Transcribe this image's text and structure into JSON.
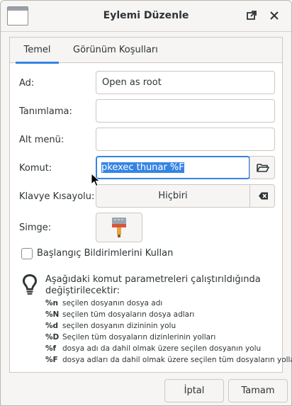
{
  "window": {
    "title": "Eylemi Düzenle"
  },
  "titlebar": {
    "icons": [
      "app-icon",
      "maximize-icon",
      "close-icon"
    ]
  },
  "tabs": [
    {
      "label": "Temel",
      "active": true
    },
    {
      "label": "Görünüm Koşulları",
      "active": false
    }
  ],
  "form": {
    "name_label": "Ad:",
    "name_value": "Open as root",
    "description_label": "Tanımlama:",
    "description_value": "",
    "submenu_label": "Alt menü:",
    "submenu_value": "",
    "command_label": "Komut:",
    "command_value": "pkexec thunar %F",
    "shortcut_label": "Klavye Kısayolu:",
    "shortcut_value": "Hiçbiri",
    "icon_label": "Simge:",
    "startup_notify_label": "Başlangıç Bildirimlerini Kullan",
    "startup_notify_checked": false
  },
  "info": {
    "text": "Aşağıdaki komut parametreleri çalıştırıldığında değiştirilecektir:",
    "params": [
      {
        "code": "%n",
        "desc": "seçilen dosyanın dosya adı"
      },
      {
        "code": "%N",
        "desc": "seçilen tüm dosyaların dosya adları"
      },
      {
        "code": "%d",
        "desc": "seçilen dosyanın dizininin yolu"
      },
      {
        "code": "%D",
        "desc": "Seçilen tüm dosyaların dizinlerinin yolları"
      },
      {
        "code": "%f",
        "desc": "dosya adı da dahil olmak üzere seçilen dosyanın yolu"
      },
      {
        "code": "%F",
        "desc": "dosya adları da dahil olmak üzere seçilen tüm dosyaların yolları"
      }
    ]
  },
  "buttons": {
    "cancel": "İptal",
    "ok": "Tamam"
  },
  "colors": {
    "accent": "#3584e4",
    "background": "#f6f5f4"
  }
}
